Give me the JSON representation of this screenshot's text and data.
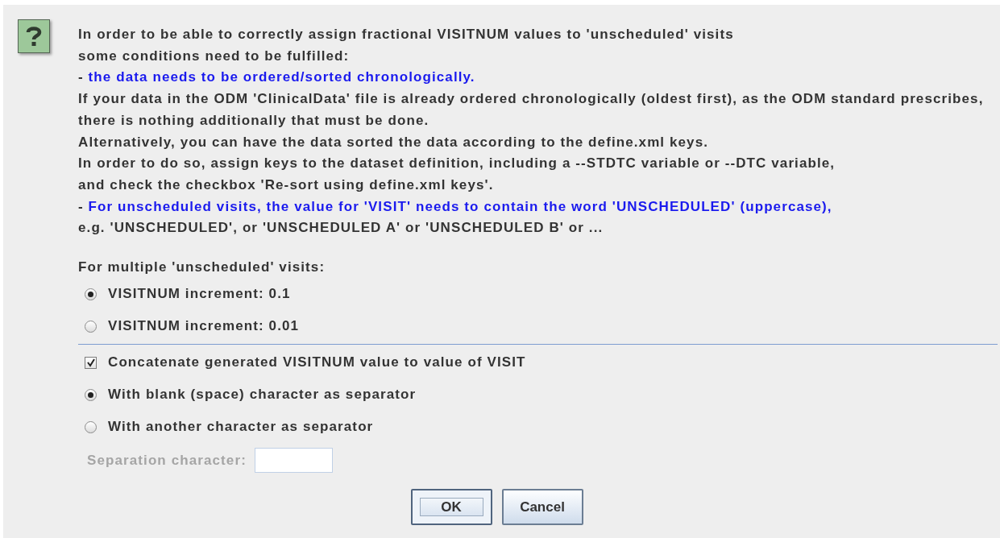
{
  "message": [
    {
      "text": "In order to be able to correctly assign fractional VISITNUM values to 'unscheduled' visits",
      "highlight": false
    },
    {
      "text": "some conditions need to be fulfilled:",
      "highlight": false
    },
    {
      "prefix": "- ",
      "text": "the data needs to be ordered/sorted chronologically.",
      "highlight": true
    },
    {
      "text": "If your data in the ODM 'ClinicalData' file is already ordered chronologically (oldest first), as the ODM standard prescribes,",
      "highlight": false
    },
    {
      "text": "there is nothing additionally that must be done.",
      "highlight": false
    },
    {
      "text": "Alternatively, you can have the data sorted the data according to the define.xml keys.",
      "highlight": false
    },
    {
      "text": "In order to do so, assign keys to the dataset definition, including a --STDTC variable or --DTC variable,",
      "highlight": false
    },
    {
      "text": "and check the checkbox 'Re-sort using define.xml keys'.",
      "highlight": false
    },
    {
      "prefix": "- ",
      "text": "For unscheduled visits, the value for 'VISIT' needs to contain the word 'UNSCHEDULED' (uppercase),",
      "highlight": true
    },
    {
      "text": "e.g. 'UNSCHEDULED', or 'UNSCHEDULED A' or 'UNSCHEDULED B' or ...",
      "highlight": false
    }
  ],
  "increment": {
    "label": "For multiple 'unscheduled' visits:",
    "options": [
      {
        "label": "VISITNUM increment: 0.1",
        "selected": true
      },
      {
        "label": "VISITNUM increment: 0.01",
        "selected": false
      }
    ]
  },
  "concatenate": {
    "label": "Concatenate generated VISITNUM value to value of VISIT",
    "checked": true
  },
  "separator_options": [
    {
      "label": "With blank (space) character as separator",
      "selected": true
    },
    {
      "label": "With another character as separator",
      "selected": false
    }
  ],
  "separation_field": {
    "label": "Separation character:",
    "disabled": true
  },
  "buttons": [
    {
      "label": "OK",
      "focused": true
    },
    {
      "label": "Cancel",
      "focused": false
    }
  ]
}
